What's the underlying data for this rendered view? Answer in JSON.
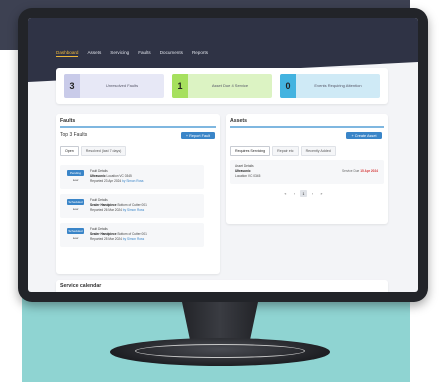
{
  "nav": {
    "items": [
      {
        "label": "Dashboard",
        "active": true
      },
      {
        "label": "Assets",
        "active": false
      },
      {
        "label": "Servicing",
        "active": false
      },
      {
        "label": "Faults",
        "active": false
      },
      {
        "label": "Documents",
        "active": false
      },
      {
        "label": "Reports",
        "active": false
      }
    ]
  },
  "stats": [
    {
      "value": "3",
      "label": "Unresolved Faults",
      "color": "#c9cbe9",
      "light": "#e7e8f6"
    },
    {
      "value": "1",
      "label": "Asset Due 4 Service",
      "color": "#a6e05e",
      "light": "#dcf3c3"
    },
    {
      "value": "0",
      "label": "Events Requiring Attention",
      "color": "#43b3e0",
      "light": "#cfeaf6"
    }
  ],
  "faults": {
    "title": "Faults",
    "subtitle": "Top 3 Faults",
    "report_button": "+ Report Fault",
    "tabs": [
      {
        "label": "Open",
        "active": true
      },
      {
        "label": "Resolved (last 7 days)",
        "active": false
      }
    ],
    "items": [
      {
        "status": "Pending",
        "priority": "Low",
        "type": "Fault Details",
        "asset": "Ultrasonic",
        "code": "Location VC 0345",
        "reported_date": "Reported 23 Apr 2024",
        "by": "by Simon Ross"
      },
      {
        "status": "Scheduled",
        "priority": "Low",
        "type": "Fault Details",
        "asset": "Sealer Handpiece",
        "code": "Bottom of Cutter 001",
        "reported_date": "Reported 26 Mar 2024",
        "by": "by Simon Ross"
      },
      {
        "status": "Scheduled",
        "priority": "Low",
        "type": "Fault Details",
        "asset": "Sealer Handpiece",
        "code": "Bottom of Cutter 001",
        "reported_date": "Reported 25 Mar 2024",
        "by": "by Simon Ross"
      }
    ]
  },
  "assets": {
    "title": "Assets",
    "create_button": "+ Create Asset",
    "tabs": [
      {
        "label": "Requires Servicing",
        "active": true
      },
      {
        "label": "Repair etc",
        "active": false
      },
      {
        "label": "Recently Added",
        "active": false
      }
    ],
    "item": {
      "type": "Asset Details",
      "name": "Ultrasonic",
      "location": "Location VC 0345",
      "due_label": "Service Due",
      "due_date": "15 Apr 2024"
    },
    "pager": {
      "first": "«",
      "prev": "‹",
      "page": "1",
      "next": "›",
      "last": "»"
    }
  },
  "calendar": {
    "title": "Service calendar"
  }
}
